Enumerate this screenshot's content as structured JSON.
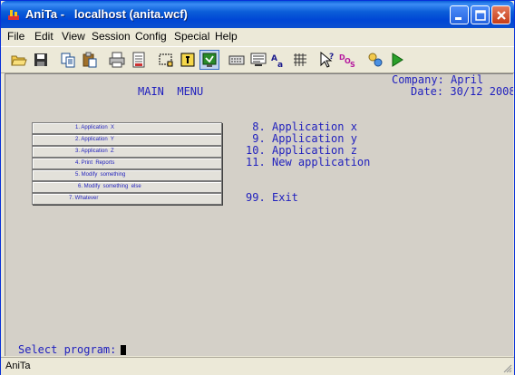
{
  "window": {
    "title": "AniTa -   localhost (anita.wcf)",
    "app_icon": "anita-app-icon",
    "controls": [
      "minimize-icon",
      "maximize-icon",
      "close-icon"
    ]
  },
  "menubar": {
    "items": [
      "File",
      "Edit",
      "View",
      "Session",
      "Config",
      "Special",
      "Help"
    ]
  },
  "toolbar": {
    "icons": [
      "open-folder-icon",
      "save-icon",
      "copy-icon",
      "paste-icon",
      "print-icon",
      "print-setup-icon",
      "select-area-icon",
      "key-icon",
      "connect-icon",
      "keyboard-icon",
      "screen-icon",
      "font-icon",
      "grid-icon",
      "help-pointer-icon",
      "dos-icon",
      "macro-icon",
      "run-icon"
    ]
  },
  "screen": {
    "company_line": "Company: April",
    "date_line": "Date: 30/12 2008",
    "menu_title": "MAIN  MENU",
    "buttons": [
      "1. Application  X",
      "2. Application  Y",
      "3. Application  Z",
      "4. Print  Reports",
      "5. Modify  something",
      "6. Modify  something  else",
      "7. Whatever"
    ],
    "options": [
      {
        "num": " 8.",
        "label": "Application x"
      },
      {
        "num": " 9.",
        "label": "Application y"
      },
      {
        "num": "10.",
        "label": "Application z"
      },
      {
        "num": "11.",
        "label": "New application"
      }
    ],
    "exit_num": "99.",
    "exit_label": "Exit",
    "prompt": "Select program:"
  },
  "statusbar": {
    "text": "AniTa"
  },
  "colors": {
    "terminal_text": "#1f1fbe",
    "terminal_bg": "#d4d0c8",
    "titlebar": "#0046d5"
  }
}
